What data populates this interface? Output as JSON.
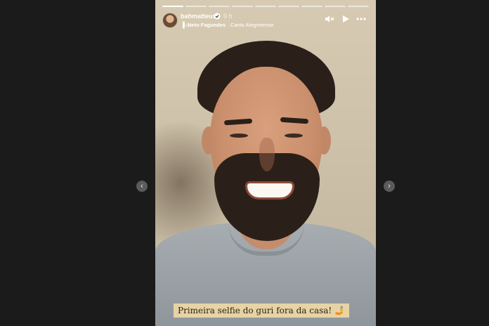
{
  "story": {
    "segments": 9,
    "active_segment": 0,
    "username": "bahmatteus",
    "time": "9 h",
    "music": {
      "artist": "Neto Fagundes",
      "separator": " · ",
      "track": "Canto Alegretense"
    },
    "caption": "Primeira selfie do guri fora da casa! 🤳"
  },
  "icons": {
    "verified": "verified-badge-icon",
    "music": "music-note-icon",
    "mute": "speaker-muted-icon",
    "play": "play-icon",
    "more": "more-options-icon",
    "prev": "chevron-left-icon",
    "next": "chevron-right-icon"
  },
  "colors": {
    "page_bg": "#1b1b1b",
    "caption_bg": "#e7d3a5",
    "nav_button": "#5b5b5b"
  }
}
